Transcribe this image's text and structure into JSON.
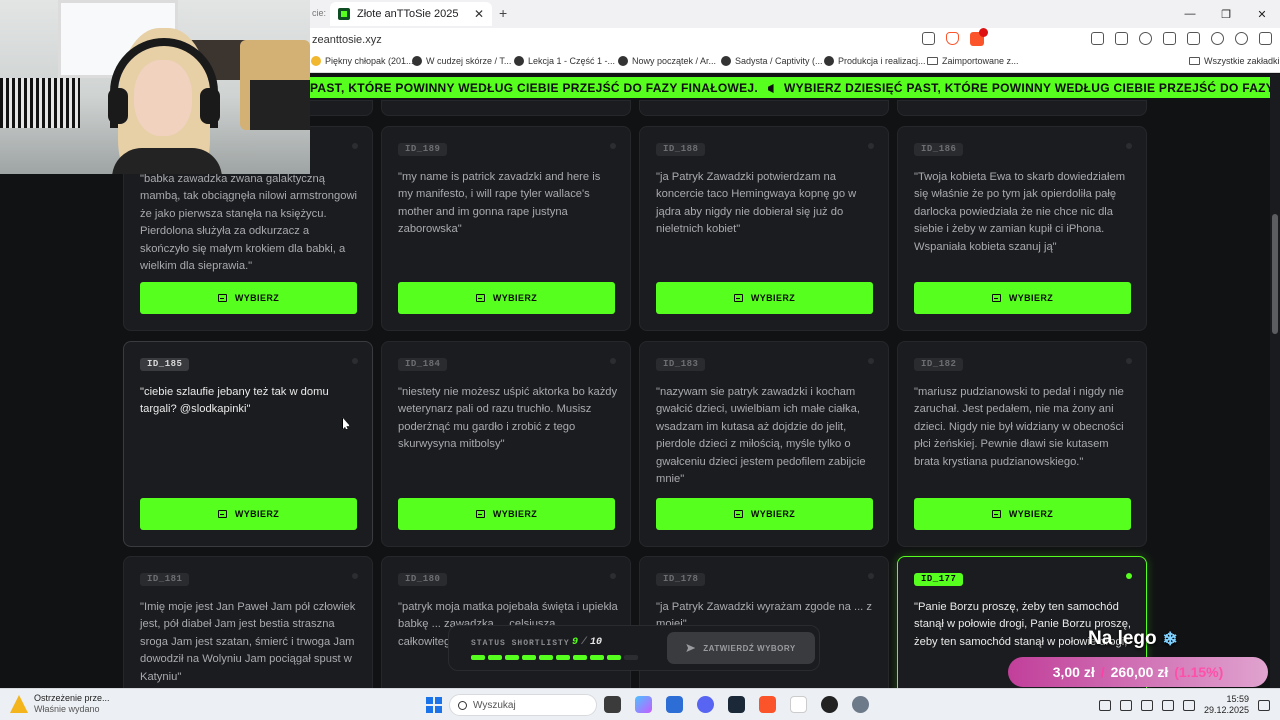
{
  "browser": {
    "tab_prev_label": "cie:",
    "tab_title": "Złote anTToSie 2025",
    "tab_close": "✕",
    "tab_new": "+",
    "url": "zeanttosie.xyz",
    "window": {
      "minimize": "—",
      "maximize": "❐",
      "close": "✕"
    },
    "bookmarks": [
      "Piękny chłopak (201...",
      "W cudzej skórze / T...",
      "Lekcja 1 - Część 1 -...",
      "Nowy początek / Ar...",
      "Sadysta / Captivity (...",
      "Produkcja i realizacj...",
      "Zaimportowane z...",
      "Wszystkie zakładki"
    ]
  },
  "banner": {
    "text_partial": "PAST, KTÓRE POWINNY WEDŁUG CIEBIE PRZEJŚĆ DO FAZY FINAŁOWEJ.",
    "text_full": "WYBIERZ DZIESIĘĆ PAST, KTÓRE POWINNY WEDŁUG CIEBIE PRZEJŚĆ DO FAZY FINAŁOWEJ."
  },
  "cards": [
    {
      "id": "",
      "quote": "\"babka zawadzka zwana galaktyczną mambą, tak obciągnęła nilowi armstrongowi że jako pierwsza stanęła na księżycu. Pierdolona służyła za odkurzacz a skończyło się małym krokiem dla babki, a wielkim dla sieprawia.\"",
      "button": "WYBIERZ"
    },
    {
      "id": "ID_189",
      "quote": "\"my name is patrick zavadzki and here is my manifesto, i will rape tyler wallace's mother and im gonna rape justyna zaborowska\"",
      "button": "WYBIERZ"
    },
    {
      "id": "ID_188",
      "quote": "\"ja Patryk Zawadzki potwierdzam na koncercie taco Hemingwaya kopnę go w jądra aby nigdy nie dobierał się już do nieletnich kobiet\"",
      "button": "WYBIERZ"
    },
    {
      "id": "ID_186",
      "quote": "\"Twoja kobieta Ewa to skarb dowiedziałem się właśnie że po tym jak opierdoliła pałę darlocka powiedziała że nie chce nic dla siebie i żeby w zamian kupił ci iPhona. Wspaniała kobieta szanuj ją\"",
      "button": "WYBIERZ"
    },
    {
      "id": "ID_185",
      "quote": "\"ciebie szlaufie jebany też tak w domu targali? @slodkapinki\"",
      "button": "WYBIERZ"
    },
    {
      "id": "ID_184",
      "quote": "\"niestety nie możesz uśpić aktorka bo każdy weterynarz pali od razu truchło. Musisz poderżnąć mu gardło i zrobić z tego skurwysyna mitbolsy\"",
      "button": "WYBIERZ"
    },
    {
      "id": "ID_183",
      "quote": "\"nazywam sie patryk zawadzki i kocham gwałcić dzieci, uwielbiam ich małe ciałka, wsadzam im kutasa aż dojdzie do jelit, pierdole dzieci z miłością, myśle tylko o gwałceniu dzieci jestem pedofilem zabijcie mnie\"",
      "button": "WYBIERZ"
    },
    {
      "id": "ID_182",
      "quote": "\"mariusz pudzianowski to pedał i nigdy nie zaruchał. Jest pedałem, nie ma żony ani dzieci. Nigdy nie był widziany w obecności płci żeńskiej. Pewnie dławi sie kutasem brata krystiana pudzianowskiego.\"",
      "button": "WYBIERZ"
    },
    {
      "id": "ID_181",
      "quote": "\"Imię moje jest Jan Paweł Jam pół człowiek jest, pół diabeł Jam jest bestia straszna sroga Jam jest szatan, śmierć i trwoga Jam dowodził na Wolyniu Jam pociągał spust w Katyniu\"",
      "button": ""
    },
    {
      "id": "ID_180",
      "quote": "\"patryk moja matka pojebała święta i upiekła babkę ... zawadzką ... celsjusza ... całkowitego spopielenia\"",
      "button": ""
    },
    {
      "id": "ID_178",
      "quote": "\"ja Patryk Zawadzki wyrażam zgode na ... z mojej\"",
      "button": ""
    },
    {
      "id": "ID_177",
      "quote": "\"Panie Borzu proszę, żeby ten samochód stanął w połowie drogi, Panie Borzu proszę, żeby ten samochód stanął w połowie drogi,\"",
      "button": ""
    }
  ],
  "status": {
    "label": "STATUS SHORTLISTY",
    "selected": "9",
    "separator": "/",
    "total": "10",
    "progress": 9,
    "progress_max": 10,
    "confirm_label": "ZATWIERDŹ WYBORY"
  },
  "overlay": {
    "title": "Na lego",
    "snow_icon": "❄",
    "current": "3,00 zł",
    "separator": "/",
    "goal": "260,00 zł",
    "percent": "(1.15%)"
  },
  "taskbar": {
    "notif_title": "Ostrzeżenie prze...",
    "notif_sub": "Właśnie wydano",
    "search_placeholder": "Wyszukaj",
    "time": "15:59",
    "date": "29.12.2025"
  },
  "colors": {
    "accent": "#57ff1f",
    "bg": "#111214",
    "card": "#1b1c1f"
  }
}
